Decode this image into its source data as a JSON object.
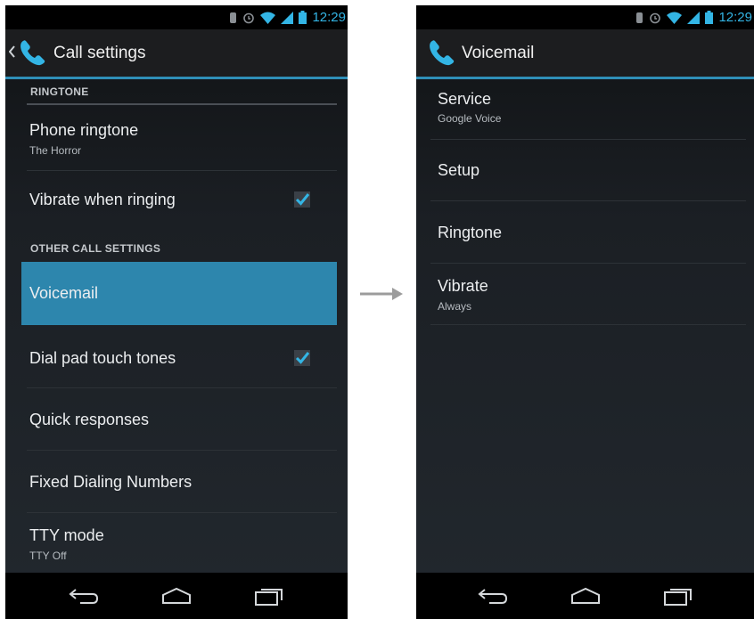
{
  "status": {
    "time": "12:29"
  },
  "left_screen": {
    "title": "Call settings",
    "sections": [
      {
        "header": "RINGTONE"
      },
      {
        "header": "OTHER CALL SETTINGS"
      }
    ],
    "items": [
      {
        "title": "Phone ringtone",
        "summary": "The Horror"
      },
      {
        "title": "Vibrate when ringing",
        "checked": true
      },
      {
        "title": "Voicemail",
        "selected": true
      },
      {
        "title": "Dial pad touch tones",
        "checked": true
      },
      {
        "title": "Quick responses"
      },
      {
        "title": "Fixed Dialing Numbers"
      },
      {
        "title": "TTY mode",
        "summary": "TTY Off"
      }
    ]
  },
  "right_screen": {
    "title": "Voicemail",
    "items": [
      {
        "title": "Service",
        "summary": "Google Voice"
      },
      {
        "title": "Setup"
      },
      {
        "title": "Ringtone"
      },
      {
        "title": "Vibrate",
        "summary": "Always"
      }
    ]
  },
  "icons": {
    "phone": "phone-handset-icon",
    "back": "back-icon",
    "home": "home-icon",
    "recents": "recent-apps-icon",
    "transition": "right-arrow-icon"
  },
  "colors": {
    "accent": "#33b5e5",
    "selected_background": "#2d86ad",
    "action_bar_underline": "#2f8fb8"
  }
}
